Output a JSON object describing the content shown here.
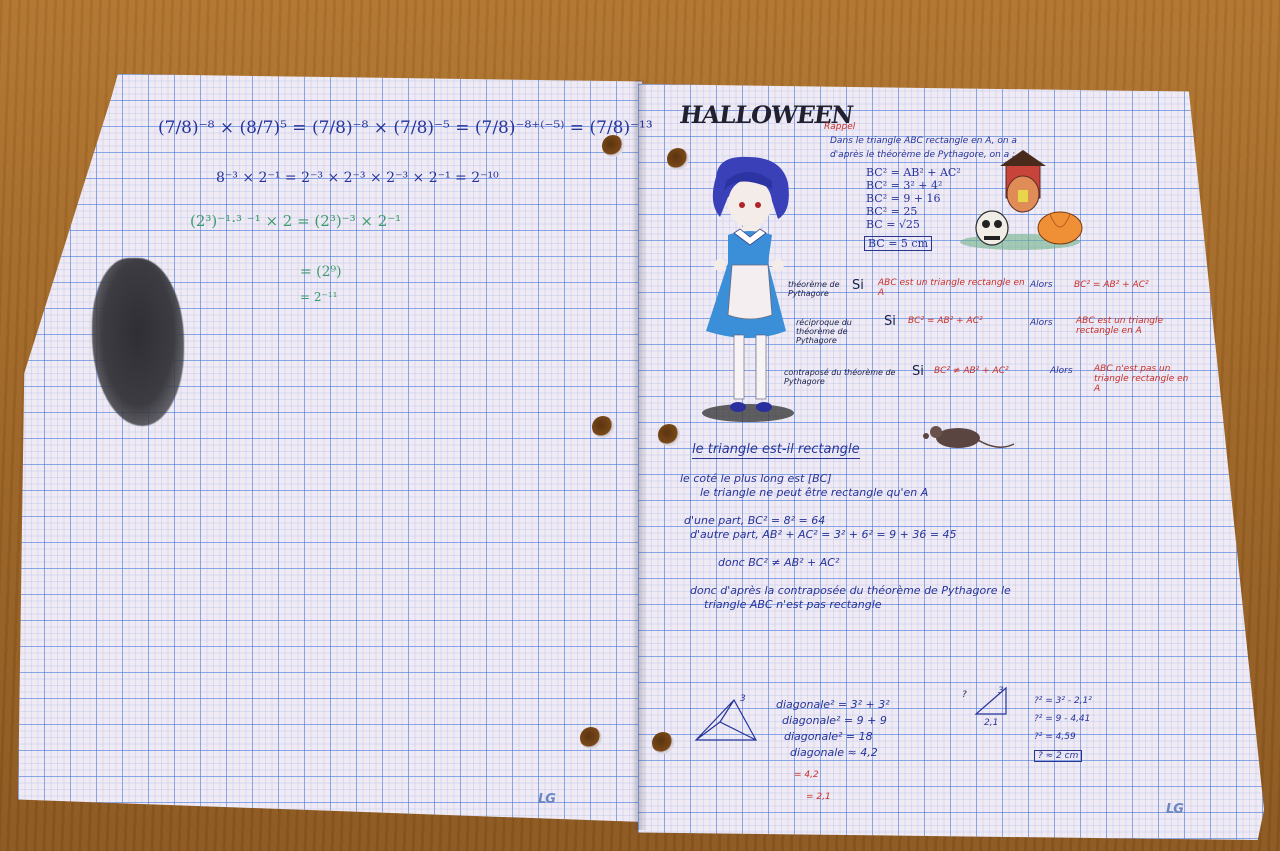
{
  "left_page": {
    "equation_1": "(7/8)⁻⁸ × (8/7)⁵ = (7/8)⁻⁸ × (7/8)⁻⁵ = (7/8)⁻⁸⁺⁽⁻⁵⁾ = (7/8)⁻¹³",
    "equation_2": "8⁻³ × 2⁻¹ = 2⁻³ × 2⁻³ × 2⁻³ × 2⁻¹ = 2⁻¹⁰",
    "equation_3": "(2³)⁻¹·³ ⁻¹ × 2 = (2³)⁻³ × 2⁻¹",
    "equation_4": "= (2⁹)",
    "equation_5": "= 2⁻¹¹",
    "brand": "LG"
  },
  "right_page": {
    "title": "HALLOWEEN",
    "rappel_label": "Rappel",
    "rappel_line_1": "Dans le triangle ABC rectangle en A, on a",
    "rappel_line_2": "d'après le théorème de Pythagore, on a :",
    "calc": [
      "BC² = AB² + AC²",
      "BC² = 3² + 4²",
      "BC² = 9 + 16",
      "BC² = 25",
      "BC = √25"
    ],
    "calc_result": "BC = 5 cm",
    "theorem_label": "théorème de Pythagore",
    "theorem_si": "Si",
    "theorem_condition": "ABC est un triangle rectangle en A",
    "theorem_alors": "Alors",
    "theorem_conclusion": "BC² = AB² + AC²",
    "reciprocal_label": "réciproque du théorème de Pythagore",
    "reciprocal_si": "Si",
    "reciprocal_condition": "BC² = AB² + AC²",
    "reciprocal_alors": "Alors",
    "reciprocal_conclusion": "ABC est un triangle rectangle en A",
    "contrapositive_label": "contraposé du théorème de Pythagore",
    "contrapositive_si": "Si",
    "contrapositive_condition": "BC² ≠ AB² + AC²",
    "contrapositive_alors": "Alors",
    "contrapositive_conclusion": "ABC n'est pas un triangle rectangle en A",
    "section_title": "le triangle est-il rectangle",
    "line_1": "le coté le plus long est [BC]",
    "line_2": "le triangle ne peut être rectangle qu'en A",
    "line_3": "d'une part, BC² = 8² = 64",
    "line_4": "d'autre part, AB² + AC² = 3² + 6² = 9 + 36 = 45",
    "line_5": "donc BC² ≠ AB² + AC²",
    "line_6": "donc d'après la contraposée du théorème de Pythagore le",
    "line_7": "triangle ABC n'est pas rectangle",
    "diag_1": "diagonale² = 3² + 3²",
    "diag_2": "diagonale² = 9 + 9",
    "diag_3": "diagonale² = 18",
    "diag_4": "diagonale ≈ 4,2",
    "diag_5": "= 4,2",
    "diag_6": "= 2,1",
    "pyramid_label": "3",
    "tri_label_1": "3",
    "tri_label_2": "2,1",
    "tri_label_q": "?",
    "side_1": "?² = 3² - 2,1²",
    "side_2": "?² = 9 - 4,41",
    "side_3": "?² = 4,59",
    "side_result": "? ≈ 2 cm",
    "brand": "LG"
  },
  "colors": {
    "ink_blue": "#27349a",
    "ink_red": "#c8302c",
    "ink_green": "#3e9b6e",
    "paper": "#efeaf3",
    "grid": "#4678dc",
    "table": "#9d6526"
  }
}
